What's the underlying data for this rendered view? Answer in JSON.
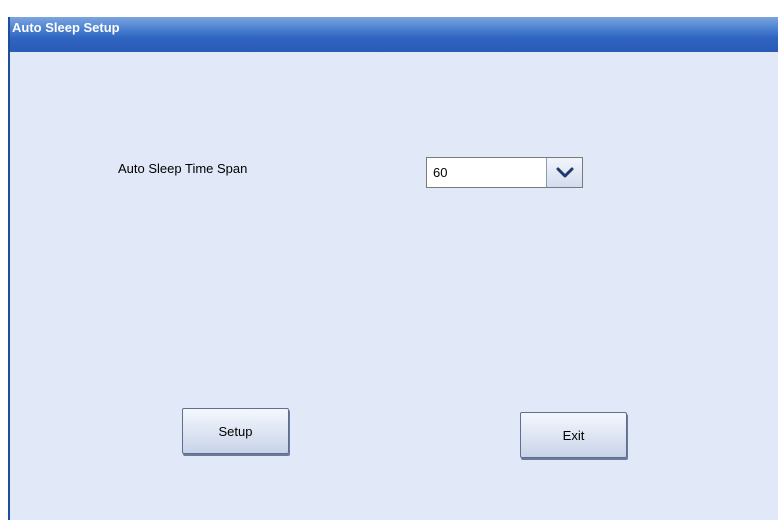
{
  "window": {
    "title": "Auto Sleep Setup"
  },
  "form": {
    "time_span_label": "Auto Sleep Time Span",
    "time_span_value": "60"
  },
  "buttons": {
    "setup_label": "Setup",
    "exit_label": "Exit"
  },
  "icons": {
    "dropdown": "chevron-down-icon"
  },
  "colors": {
    "titlebar": "#2f65c1",
    "panel_background": "#e1e8f8",
    "title_text": "#ffffff"
  }
}
